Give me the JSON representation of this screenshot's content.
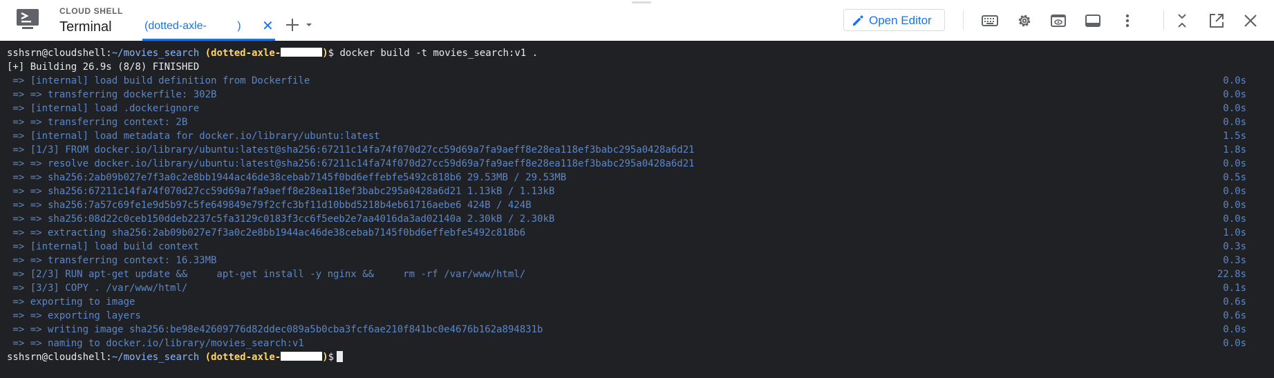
{
  "header": {
    "product": "CLOUD SHELL",
    "title": "Terminal",
    "tab": {
      "label": "(dotted-axle-          )"
    },
    "open_editor": "Open Editor",
    "icons": [
      "keyboard-icon",
      "gear-icon",
      "web-preview-icon",
      "layout-icon",
      "more-vert-icon",
      "minimize-icon",
      "open-new-window-icon",
      "close-icon"
    ]
  },
  "colors": {
    "accent": "#1a73e8",
    "terminal_bg": "#202124",
    "log_text": "#5b86c7",
    "prompt_project": "#fdd663"
  },
  "terminal": {
    "prompt": {
      "user": "sshsrn@cloudshell",
      "colon": ":",
      "path": "~/movies_search",
      "project": "(dotted-axle-",
      "project_end": ")",
      "dollar": "$"
    },
    "command": "docker build -t movies_search:v1 .",
    "building": "[+] Building 26.9s (8/8) FINISHED",
    "lines": [
      {
        "text": " => [internal] load build definition from Dockerfile",
        "time": "0.0s"
      },
      {
        "text": " => => transferring dockerfile: 302B",
        "time": "0.0s"
      },
      {
        "text": " => [internal] load .dockerignore",
        "time": "0.0s"
      },
      {
        "text": " => => transferring context: 2B",
        "time": "0.0s"
      },
      {
        "text": " => [internal] load metadata for docker.io/library/ubuntu:latest",
        "time": "1.5s"
      },
      {
        "text": " => [1/3] FROM docker.io/library/ubuntu:latest@sha256:67211c14fa74f070d27cc59d69a7fa9aeff8e28ea118ef3babc295a0428a6d21",
        "time": "1.8s"
      },
      {
        "text": " => => resolve docker.io/library/ubuntu:latest@sha256:67211c14fa74f070d27cc59d69a7fa9aeff8e28ea118ef3babc295a0428a6d21",
        "time": "0.0s"
      },
      {
        "text": " => => sha256:2ab09b027e7f3a0c2e8bb1944ac46de38cebab7145f0bd6effebfe5492c818b6 29.53MB / 29.53MB",
        "time": "0.5s"
      },
      {
        "text": " => => sha256:67211c14fa74f070d27cc59d69a7fa9aeff8e28ea118ef3babc295a0428a6d21 1.13kB / 1.13kB",
        "time": "0.0s"
      },
      {
        "text": " => => sha256:7a57c69fe1e9d5b97c5fe649849e79f2cfc3bf11d10bbd5218b4eb61716aebe6 424B / 424B",
        "time": "0.0s"
      },
      {
        "text": " => => sha256:08d22c0ceb150ddeb2237c5fa3129c0183f3cc6f5eeb2e7aa4016da3ad02140a 2.30kB / 2.30kB",
        "time": "0.0s"
      },
      {
        "text": " => => extracting sha256:2ab09b027e7f3a0c2e8bb1944ac46de38cebab7145f0bd6effebfe5492c818b6",
        "time": "1.0s"
      },
      {
        "text": " => [internal] load build context",
        "time": "0.3s"
      },
      {
        "text": " => => transferring context: 16.33MB",
        "time": "0.3s"
      },
      {
        "text": " => [2/3] RUN apt-get update &&     apt-get install -y nginx &&     rm -rf /var/www/html/",
        "time": "22.8s"
      },
      {
        "text": " => [3/3] COPY . /var/www/html/",
        "time": "0.1s"
      },
      {
        "text": " => exporting to image",
        "time": "0.6s"
      },
      {
        "text": " => => exporting layers",
        "time": "0.6s"
      },
      {
        "text": " => => writing image sha256:be98e42609776d82ddec089a5b0cba3fcf6ae210f841bc0e4676b162a894831b",
        "time": "0.0s"
      },
      {
        "text": " => => naming to docker.io/library/movies_search:v1",
        "time": "0.0s"
      }
    ]
  }
}
